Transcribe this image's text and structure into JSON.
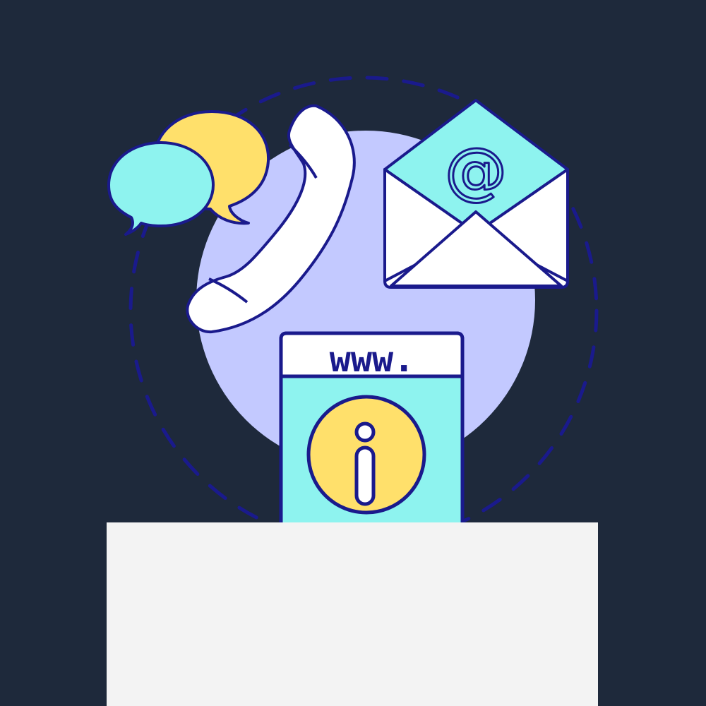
{
  "illustration": {
    "browser": {
      "url_text": "www."
    },
    "email": {
      "at_symbol": "@"
    },
    "info": {
      "letter": "i"
    },
    "icons": {
      "chat": "speech-bubbles-icon",
      "phone": "telephone-handset-icon",
      "email": "envelope-at-icon",
      "browser": "website-info-icon"
    }
  },
  "colors": {
    "background": "#1e293b",
    "outline": "#1a1a8c",
    "circle_fill": "#c3c9ff",
    "cyan": "#8ef3ef",
    "yellow": "#ffe06b",
    "white": "#ffffff",
    "panel": "#f3f3f3"
  }
}
